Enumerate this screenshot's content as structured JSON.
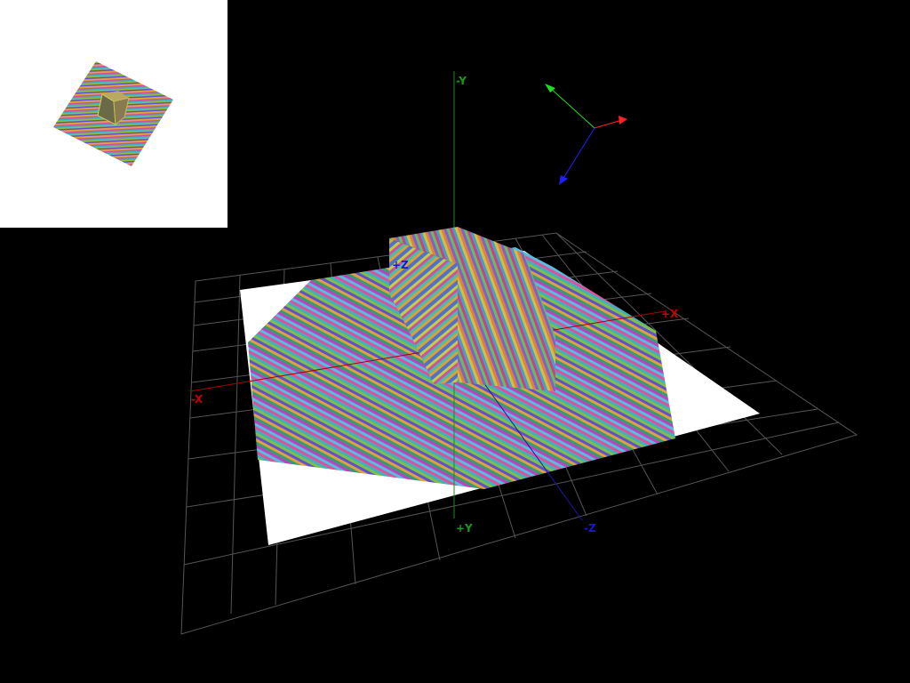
{
  "viewport": {
    "background": "#000000"
  },
  "axes": {
    "pos_x_label": "+X",
    "neg_x_label": "-X",
    "pos_y_label": "+Y",
    "neg_y_label": "-Y",
    "pos_z_label": "+Z",
    "neg_z_label": "-Z",
    "x_color": "#cc0000",
    "y_color": "#1a9a1a",
    "z_color": "#1a1acc"
  },
  "gizmo": {
    "x_color": "#ff2020",
    "y_color": "#20dd20",
    "z_color": "#2020ff"
  },
  "minimap": {
    "background": "#ffffff"
  },
  "scene": {
    "grid_color": "#555555",
    "ground_color": "#ffffff",
    "objects": [
      "textured-plane",
      "textured-cube"
    ]
  }
}
